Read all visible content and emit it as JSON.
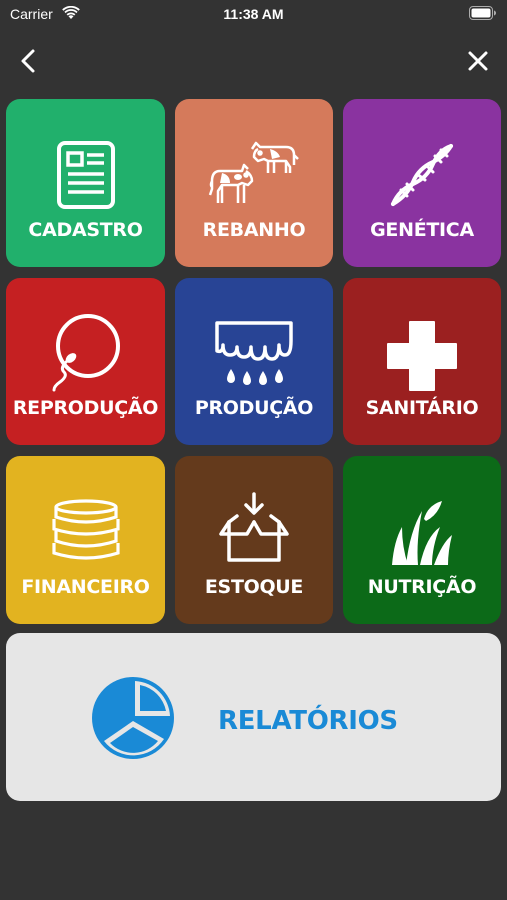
{
  "status_bar": {
    "carrier": "Carrier",
    "time": "11:38 AM"
  },
  "nav": {
    "back_icon": "chevron-left-icon",
    "close_icon": "close-icon"
  },
  "tiles": [
    {
      "label": "CADASTRO",
      "color": "#21b06c",
      "icon": "document-icon"
    },
    {
      "label": "REBANHO",
      "color": "#d57a5b",
      "icon": "cattle-icon"
    },
    {
      "label": "GENÉTICA",
      "color": "#8a33a0",
      "icon": "dna-icon"
    },
    {
      "label": "REPRODUÇÃO",
      "color": "#c52022",
      "icon": "sperm-egg-icon"
    },
    {
      "label": "PRODUÇÃO",
      "color": "#284495",
      "icon": "milk-drops-icon"
    },
    {
      "label": "SANITÁRIO",
      "color": "#9b2020",
      "icon": "medical-cross-icon"
    },
    {
      "label": "FINANCEIRO",
      "color": "#e2b320",
      "icon": "coins-icon"
    },
    {
      "label": "ESTOQUE",
      "color": "#643a1c",
      "icon": "box-icon"
    },
    {
      "label": "NUTRIÇÃO",
      "color": "#0c6a18",
      "icon": "grass-icon"
    }
  ],
  "report": {
    "label": "RELATÓRIOS",
    "color": "#1a8ad6",
    "icon": "pie-chart-icon"
  }
}
